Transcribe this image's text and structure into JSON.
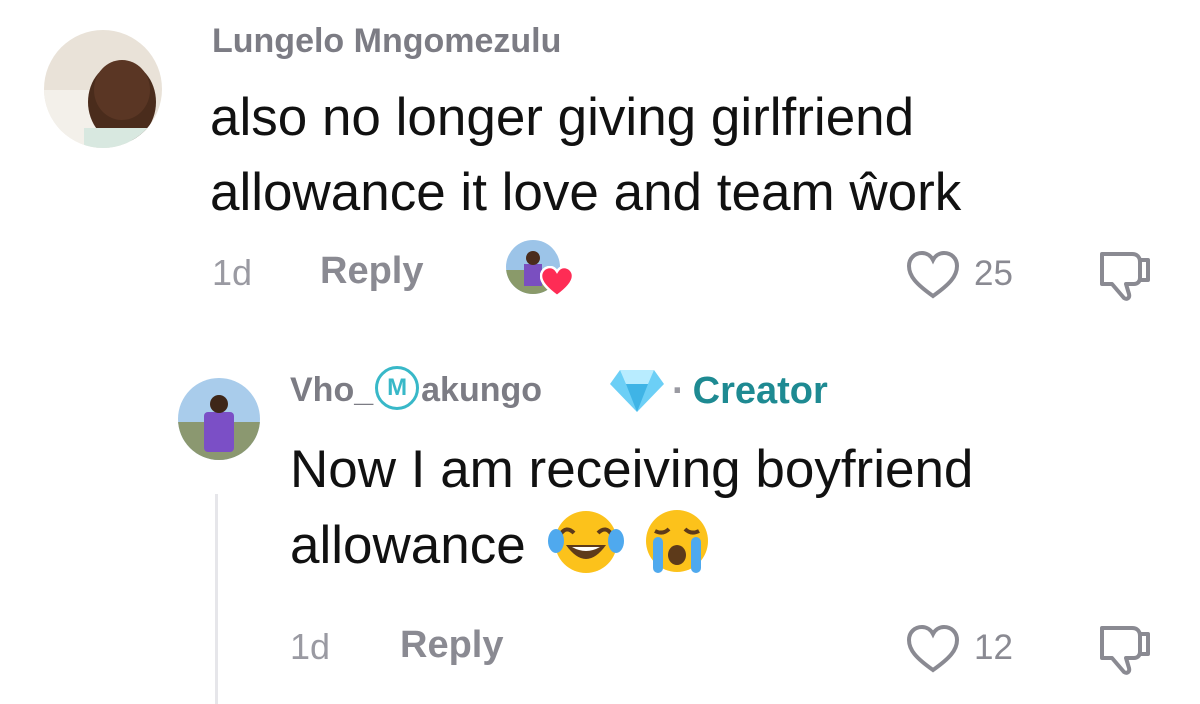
{
  "comment": {
    "username": "Lungelo Mngomezulu",
    "text_line1": "also no longer giving girlfriend",
    "text_line2": "allowance it love and team ŵork",
    "time": "1d",
    "reply_label": "Reply",
    "like_count": "25"
  },
  "reply": {
    "username_prefix": "Vho_",
    "username_badge": "M",
    "username_suffix": "akungo",
    "separator": "·",
    "role_label": "Creator",
    "text_line1": "Now I am receiving boyfriend",
    "text_line2": "allowance",
    "emojis": [
      "face-with-tears-of-joy",
      "loudly-crying-face"
    ],
    "time": "1d",
    "reply_label": "Reply",
    "like_count": "12"
  },
  "colors": {
    "creator": "#1e8a92",
    "liked_heart": "#fe2c55",
    "diamond": "#6ccff6"
  }
}
